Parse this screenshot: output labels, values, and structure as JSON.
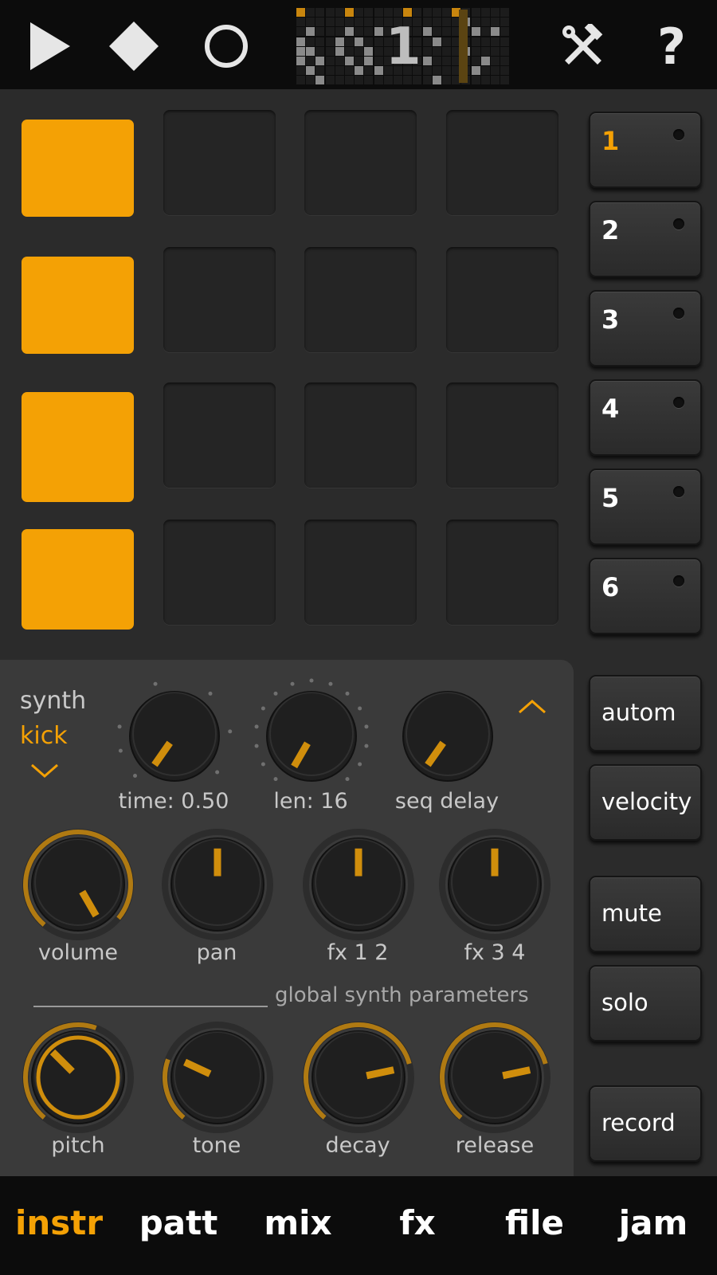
{
  "topbar": {
    "play_icon": "play-icon",
    "stop_icon": "stop-diamond-icon",
    "record_icon": "record-circle-icon",
    "pattern_number": "1",
    "tools_icon": "hammer-wrench-icon",
    "help_label": "?"
  },
  "pads": [
    [
      true,
      false,
      false,
      false
    ],
    [
      true,
      false,
      false,
      false
    ],
    [
      true,
      false,
      false,
      false
    ],
    [
      true,
      false,
      false,
      false
    ]
  ],
  "tracks": [
    {
      "label": "1",
      "active": true
    },
    {
      "label": "2",
      "active": false
    },
    {
      "label": "3",
      "active": false
    },
    {
      "label": "4",
      "active": false
    },
    {
      "label": "5",
      "active": false
    },
    {
      "label": "6",
      "active": false
    }
  ],
  "side_buttons": {
    "autom": "autom",
    "velocity": "velocity",
    "mute": "mute",
    "solo": "solo",
    "record": "record"
  },
  "instrument": {
    "type": "synth",
    "name": "kick"
  },
  "knobs": {
    "time": "time: 0.50",
    "len": "len: 16",
    "seq_delay": "seq delay",
    "volume": "volume",
    "pan": "pan",
    "fx12": "fx 1 2",
    "fx34": "fx 3 4",
    "pitch": "pitch",
    "tone": "tone",
    "decay": "decay",
    "release": "release"
  },
  "global_label": "global synth parameters",
  "tabs": [
    {
      "label": "instr",
      "active": true
    },
    {
      "label": "patt",
      "active": false
    },
    {
      "label": "mix",
      "active": false
    },
    {
      "label": "fx",
      "active": false
    },
    {
      "label": "file",
      "active": false
    },
    {
      "label": "jam",
      "active": false
    }
  ],
  "colors": {
    "accent": "#f4a105",
    "background": "#2b2b2b",
    "panel": "#3a3a3a",
    "bar": "#0c0c0c"
  }
}
